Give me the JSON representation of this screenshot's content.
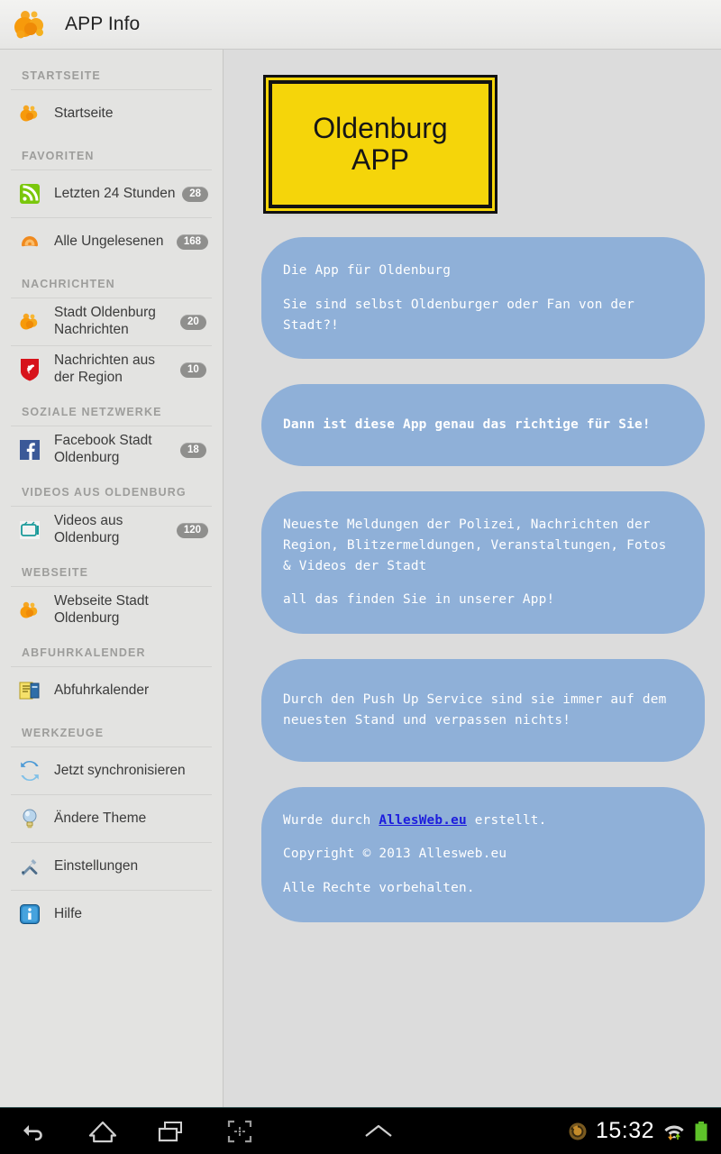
{
  "actionbar": {
    "title": "APP Info",
    "logo_icon": "orange-blob-logo"
  },
  "sidebar": {
    "sections": [
      {
        "header": "STARTSEITE",
        "items": [
          {
            "label": "Startseite",
            "icon": "orange-blob-icon",
            "badge": null
          }
        ]
      },
      {
        "header": "FAVORITEN",
        "items": [
          {
            "label": "Letzten 24 Stunden",
            "icon": "rss-feed-icon",
            "badge": "28"
          },
          {
            "label": "Alle Ungelesenen",
            "icon": "orange-feed-icon",
            "badge": "168"
          }
        ]
      },
      {
        "header": "NACHRICHTEN",
        "items": [
          {
            "label": "Stadt Oldenburg Nachrichten",
            "icon": "orange-blob-icon",
            "badge": "20"
          },
          {
            "label": "Nachrichten aus der Region",
            "icon": "lower-saxony-crest-icon",
            "badge": "10"
          }
        ]
      },
      {
        "header": "SOZIALE NETZWERKE",
        "items": [
          {
            "label": "Facebook Stadt Oldenburg",
            "icon": "facebook-icon",
            "badge": "18"
          }
        ]
      },
      {
        "header": "VIDEOS AUS OLDENBURG",
        "items": [
          {
            "label": "Videos aus Oldenburg",
            "icon": "tv-icon",
            "badge": "120"
          }
        ]
      },
      {
        "header": "WEBSEITE",
        "items": [
          {
            "label": "Webseite Stadt Oldenburg",
            "icon": "orange-blob-icon",
            "badge": null
          }
        ]
      },
      {
        "header": "ABFUHRKALENDER",
        "items": [
          {
            "label": "Abfuhrkalender",
            "icon": "calendar-waste-icon",
            "badge": null
          }
        ]
      },
      {
        "header": "WERKZEUGE",
        "items": [
          {
            "label": "Jetzt synchronisieren",
            "icon": "sync-icon",
            "badge": null
          },
          {
            "label": "Ändere Theme",
            "icon": "lightbulb-icon",
            "badge": null
          },
          {
            "label": "Einstellungen",
            "icon": "tools-icon",
            "badge": null
          },
          {
            "label": "Hilfe",
            "icon": "info-icon",
            "badge": null
          }
        ]
      }
    ]
  },
  "content": {
    "sign": {
      "line1": "Oldenburg",
      "line2": "APP",
      "bg_color": "#f5d50a",
      "border_color": "#121212"
    },
    "bubbles": [
      {
        "bubble_color": "#8fb0d8",
        "paragraphs": [
          "Die App für Oldenburg",
          "Sie sind selbst Oldenburger oder Fan von der Stadt?!"
        ]
      },
      {
        "bubble_color": "#8fb0d8",
        "bold": true,
        "paragraphs": [
          "Dann ist diese App genau das richtige für Sie!"
        ]
      },
      {
        "bubble_color": "#8fb0d8",
        "paragraphs": [
          "Neueste Meldungen der Polizei, Nachrichten der Region, Blitzermeldungen, Veranstaltungen, Fotos & Videos der Stadt",
          "all das finden Sie in unserer App!"
        ]
      },
      {
        "bubble_color": "#8fb0d8",
        "paragraphs": [
          "Durch den Push Up Service sind sie immer auf dem neuesten Stand und verpassen nichts!"
        ]
      }
    ],
    "footer": {
      "bubble_color": "#8fb0d8",
      "line1_prefix": "Wurde durch ",
      "link_text": "AllesWeb.eu",
      "link_color": "#1d1ddd",
      "line1_suffix": " erstellt.",
      "line2": "Copyright © 2013 Allesweb.eu",
      "line3": "Alle Rechte vorbehalten."
    }
  },
  "navbar": {
    "buttons": [
      {
        "name": "back-icon",
        "label": "Back"
      },
      {
        "name": "home-icon",
        "label": "Home"
      },
      {
        "name": "recents-icon",
        "label": "Recent apps"
      },
      {
        "name": "screenshot-icon",
        "label": "Screenshot"
      },
      {
        "name": "chevron-up-icon",
        "label": "Expand"
      }
    ],
    "status": {
      "sync_icon": "sync-status-icon",
      "clock": "15:32",
      "wifi_icon": "wifi-icon",
      "battery_icon": "battery-full-icon",
      "battery_color": "#5ec22a"
    }
  }
}
